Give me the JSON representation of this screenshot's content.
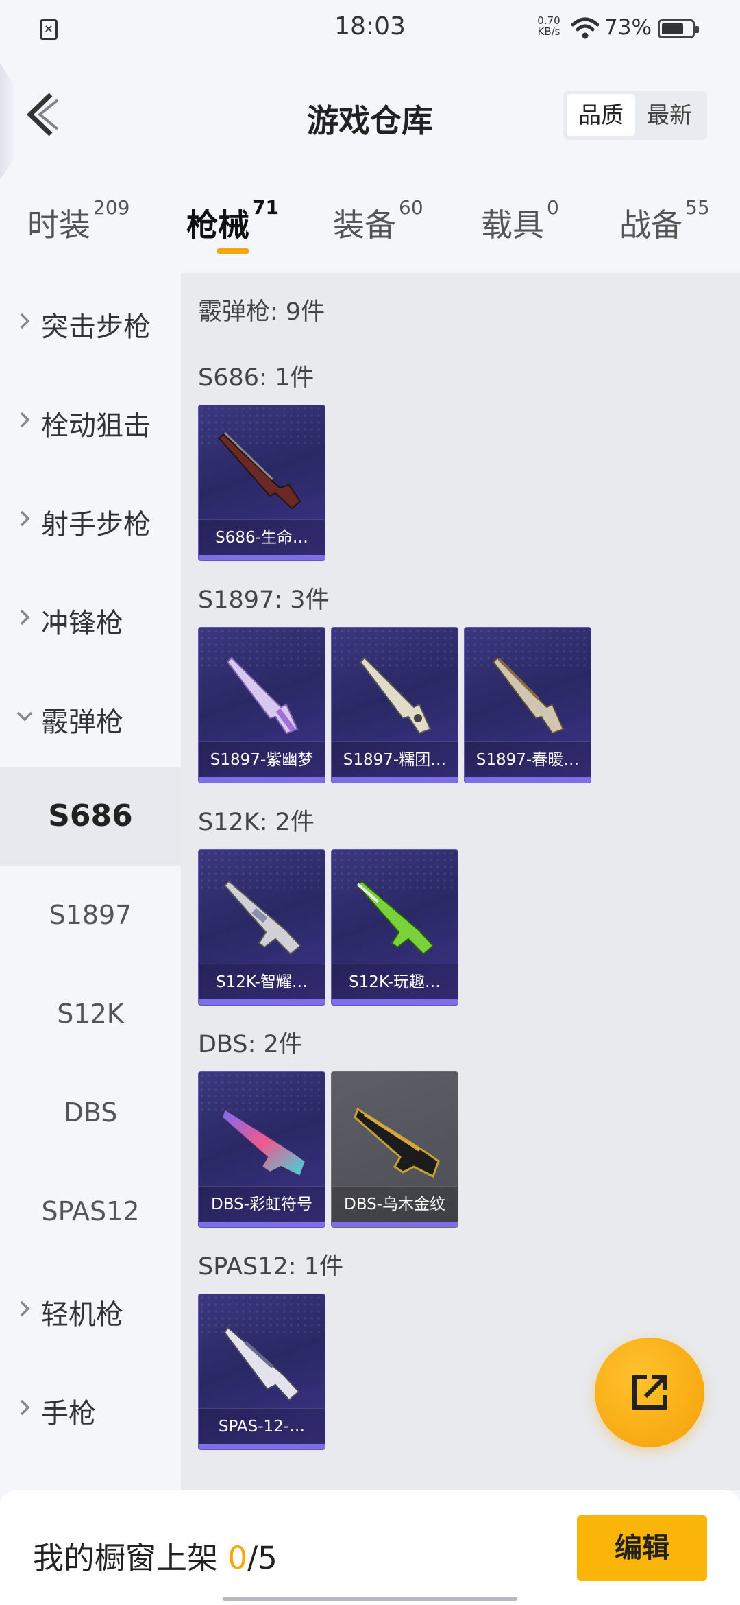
{
  "status_bar": {
    "time": "18:03",
    "net_speed_value": "0.70",
    "net_speed_unit": "KB/s",
    "battery_percent": "73%",
    "battery_level": 0.73
  },
  "header": {
    "title": "游戏仓库",
    "sort_options": [
      "品质",
      "最新"
    ],
    "sort_selected": "品质"
  },
  "category_tabs": [
    {
      "label": "时装",
      "count": "209"
    },
    {
      "label": "枪械",
      "count": "71",
      "active": true
    },
    {
      "label": "装备",
      "count": "60"
    },
    {
      "label": "载具",
      "count": "0"
    },
    {
      "label": "战备",
      "count": "55"
    }
  ],
  "sidebar": {
    "categories": {
      "assault_rifle": "突击步枪",
      "bolt_sniper": "栓动狙击",
      "marksman_rifle": "射手步枪",
      "smg": "冲锋枪",
      "shotgun": "霰弹枪",
      "lmg": "轻机枪",
      "pistol": "手枪"
    },
    "shotgun_subitems": [
      "S686",
      "S1897",
      "S12K",
      "DBS",
      "SPAS12"
    ],
    "selected_subitem": "S686"
  },
  "main": {
    "summary": "霰弹枪: 9件",
    "groups": [
      {
        "title": "S686: 1件",
        "items": [
          "S686-生命…"
        ]
      },
      {
        "title": "S1897: 3件",
        "items": [
          "S1897-紫幽梦",
          "S1897-糯团…",
          "S1897-春暖…"
        ]
      },
      {
        "title": "S12K: 2件",
        "items": [
          "S12K-智耀…",
          "S12K-玩趣…"
        ]
      },
      {
        "title": "DBS: 2件",
        "items": [
          "DBS-彩虹符号",
          "DBS-乌木金纹"
        ]
      },
      {
        "title": "SPAS12: 1件",
        "items": [
          "SPAS-12-…"
        ]
      }
    ]
  },
  "bottom_bar": {
    "showcase_label": "我的橱窗上架 ",
    "showcase_count": "0",
    "showcase_total": "/5",
    "edit_label": "编辑"
  },
  "colors": {
    "accent": "#f7a90b",
    "card_purple": "#2a2864",
    "card_grey": "#55565d",
    "edit_button": "#fab508"
  }
}
